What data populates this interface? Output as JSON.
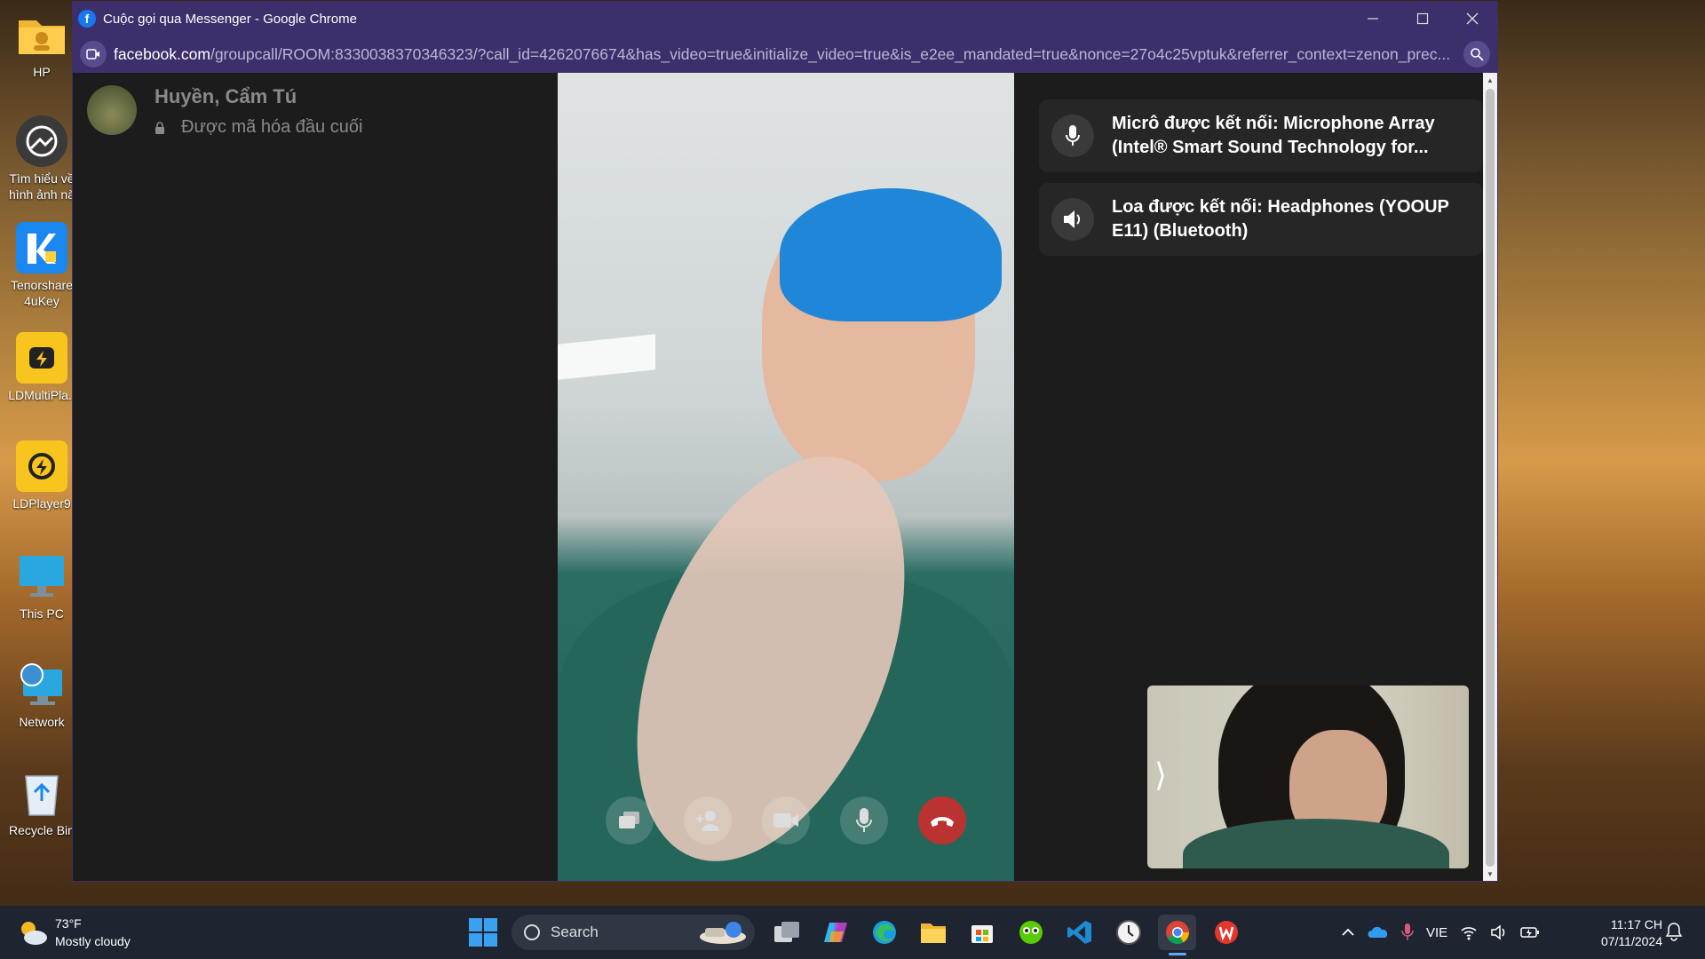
{
  "desktop": {
    "icons": [
      {
        "label": "HP",
        "icon": "folder-icon"
      },
      {
        "label": "Tìm hiểu về hình ảnh nà",
        "icon": "learn-about-picture-icon"
      },
      {
        "label": "Tenorshare 4uKey",
        "icon": "tenorshare-4ukey-icon"
      },
      {
        "label": "LDMultiPla..",
        "icon": "ldmultiplayer-icon"
      },
      {
        "label": "LDPlayer9",
        "icon": "ldplayer-icon"
      },
      {
        "label": "This PC",
        "icon": "this-pc-icon"
      },
      {
        "label": "Network",
        "icon": "network-icon"
      },
      {
        "label": "Recycle Bin",
        "icon": "recycle-bin-icon"
      }
    ]
  },
  "window": {
    "title": "Cuộc gọi qua Messenger - Google Chrome",
    "favicon": "f",
    "url_host": "facebook.com",
    "url_path": "/groupcall/ROOM:8330038370346323/?call_id=4262076674&has_video=true&initialize_video=true&is_e2ee_mandated=true&nonce=27o4c25vptuk&referrer_context=zenon_prec..."
  },
  "call": {
    "participant_name": "Huyền, Cẩm Tú",
    "encryption_text": "Được mã hóa đầu cuối",
    "notifications": [
      {
        "icon": "microphone-icon",
        "text": "Micrô được kết nối: Microphone Array (Intel® Smart Sound Technology for..."
      },
      {
        "icon": "speaker-icon",
        "text": "Loa được kết nối: Headphones (YOOUP E11) (Bluetooth)"
      }
    ],
    "selfview_toggle": "⟩"
  },
  "taskbar": {
    "weather_temp": "73°F",
    "weather_desc": "Mostly cloudy",
    "search_label": "Search",
    "language": "VIE",
    "time": "11:17 CH",
    "date": "07/11/2024",
    "colors": {
      "accent": "#60a8ff",
      "window_frame": "#3d2f6b",
      "end_call": "#d52a2a"
    }
  }
}
